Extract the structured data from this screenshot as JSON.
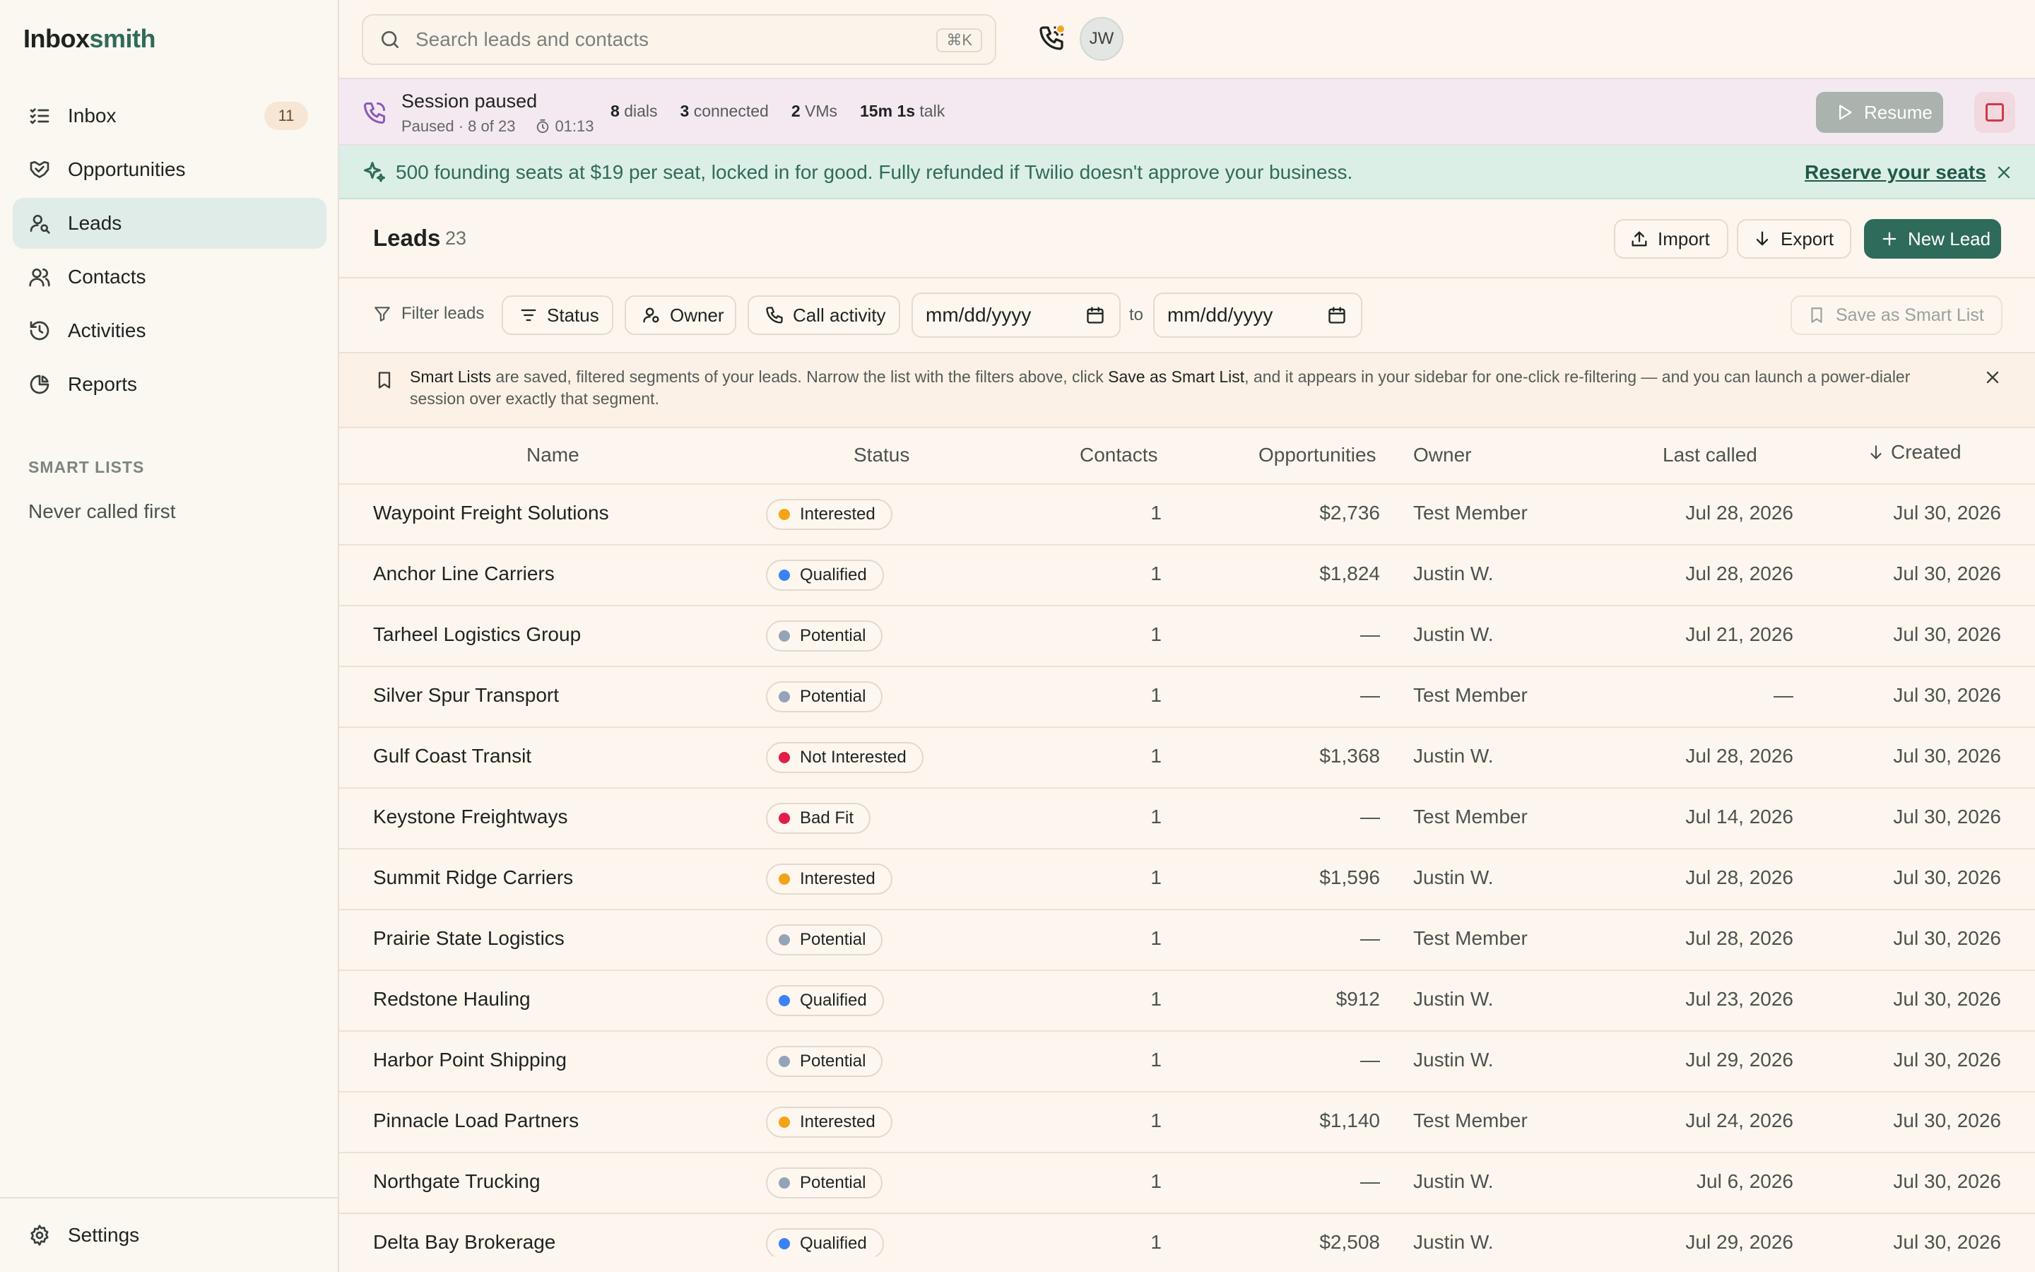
{
  "app": {
    "brand_main": "Inbox",
    "brand_accent": "smith"
  },
  "sidebar": {
    "items": [
      {
        "label": "Inbox",
        "icon": "list-check-icon",
        "badge": "11"
      },
      {
        "label": "Opportunities",
        "icon": "handshake-icon"
      },
      {
        "label": "Leads",
        "icon": "user-search-icon",
        "active": true
      },
      {
        "label": "Contacts",
        "icon": "users-icon"
      },
      {
        "label": "Activities",
        "icon": "history-icon"
      },
      {
        "label": "Reports",
        "icon": "pie-chart-icon"
      }
    ],
    "smart_lists_heading": "SMART LISTS",
    "smart_lists": [
      "Never called first"
    ],
    "settings_label": "Settings"
  },
  "topbar": {
    "search_placeholder": "Search leads and contacts",
    "shortcut": "⌘K",
    "avatar_initials": "JW"
  },
  "session": {
    "title": "Session paused",
    "status": "Paused · 8 of 23",
    "timer": "01:13",
    "stats": [
      {
        "value": "8",
        "label": "dials"
      },
      {
        "value": "3",
        "label": "connected"
      },
      {
        "value": "2",
        "label": "VMs"
      },
      {
        "value": "15m 1s",
        "label": "talk"
      }
    ],
    "resume_label": "Resume"
  },
  "promo": {
    "text": "500 founding seats at $19 per seat, locked in for good. Fully refunded if Twilio doesn't approve your business.",
    "link": "Reserve your seats"
  },
  "leads_header": {
    "title": "Leads",
    "count": "23",
    "import_label": "Import",
    "export_label": "Export",
    "new_label": "New Lead"
  },
  "filters": {
    "filter_label": "Filter leads",
    "chips": [
      "Status",
      "Owner",
      "Call activity"
    ],
    "date_from_placeholder": "mm/dd/yyyy",
    "date_to_placeholder": "mm/dd/yyyy",
    "to_label": "to",
    "save_label": "Save as Smart List"
  },
  "info": {
    "strong1": "Smart Lists",
    "text1": " are saved, filtered segments of your leads. Narrow the list with the filters above, click ",
    "strong2": "Save as Smart List",
    "text2": ", and it appears in your sidebar for one-click re-filtering — and you can launch a power-dialer session over exactly that segment."
  },
  "table": {
    "columns": [
      "Name",
      "Status",
      "Contacts",
      "Opportunities",
      "Owner",
      "Last called",
      "Created"
    ],
    "rows": [
      {
        "name": "Waypoint Freight Solutions",
        "status": "Interested",
        "contacts": "1",
        "opps": "$2,736",
        "owner": "Test Member",
        "last_called": "Jul 28, 2026",
        "created": "Jul 30, 2026"
      },
      {
        "name": "Anchor Line Carriers",
        "status": "Qualified",
        "contacts": "1",
        "opps": "$1,824",
        "owner": "Justin W.",
        "last_called": "Jul 28, 2026",
        "created": "Jul 30, 2026"
      },
      {
        "name": "Tarheel Logistics Group",
        "status": "Potential",
        "contacts": "1",
        "opps": "—",
        "owner": "Justin W.",
        "last_called": "Jul 21, 2026",
        "created": "Jul 30, 2026"
      },
      {
        "name": "Silver Spur Transport",
        "status": "Potential",
        "contacts": "1",
        "opps": "—",
        "owner": "Test Member",
        "last_called": "—",
        "created": "Jul 30, 2026"
      },
      {
        "name": "Gulf Coast Transit",
        "status": "Not Interested",
        "contacts": "1",
        "opps": "$1,368",
        "owner": "Justin W.",
        "last_called": "Jul 28, 2026",
        "created": "Jul 30, 2026"
      },
      {
        "name": "Keystone Freightways",
        "status": "Bad Fit",
        "contacts": "1",
        "opps": "—",
        "owner": "Test Member",
        "last_called": "Jul 14, 2026",
        "created": "Jul 30, 2026"
      },
      {
        "name": "Summit Ridge Carriers",
        "status": "Interested",
        "contacts": "1",
        "opps": "$1,596",
        "owner": "Justin W.",
        "last_called": "Jul 28, 2026",
        "created": "Jul 30, 2026"
      },
      {
        "name": "Prairie State Logistics",
        "status": "Potential",
        "contacts": "1",
        "opps": "—",
        "owner": "Test Member",
        "last_called": "Jul 28, 2026",
        "created": "Jul 30, 2026"
      },
      {
        "name": "Redstone Hauling",
        "status": "Qualified",
        "contacts": "1",
        "opps": "$912",
        "owner": "Justin W.",
        "last_called": "Jul 23, 2026",
        "created": "Jul 30, 2026"
      },
      {
        "name": "Harbor Point Shipping",
        "status": "Potential",
        "contacts": "1",
        "opps": "—",
        "owner": "Justin W.",
        "last_called": "Jul 29, 2026",
        "created": "Jul 30, 2026"
      },
      {
        "name": "Pinnacle Load Partners",
        "status": "Interested",
        "contacts": "1",
        "opps": "$1,140",
        "owner": "Test Member",
        "last_called": "Jul 24, 2026",
        "created": "Jul 30, 2026"
      },
      {
        "name": "Northgate Trucking",
        "status": "Potential",
        "contacts": "1",
        "opps": "—",
        "owner": "Justin W.",
        "last_called": "Jul 6, 2026",
        "created": "Jul 30, 2026"
      },
      {
        "name": "Delta Bay Brokerage",
        "status": "Qualified",
        "contacts": "1",
        "opps": "$2,508",
        "owner": "Justin W.",
        "last_called": "Jul 29, 2026",
        "created": "Jul 30, 2026"
      }
    ]
  },
  "status_colors": {
    "Interested": "#f2a417",
    "Qualified": "#3b82f6",
    "Potential": "#94a3b8",
    "Not Interested": "#e11d48",
    "Bad Fit": "#e11d48"
  },
  "colors": {
    "accent": "#2f6b5a",
    "session_bg": "#f5e9f1",
    "promo_bg": "#dcefe6",
    "page_bg": "#fdf6ee"
  }
}
